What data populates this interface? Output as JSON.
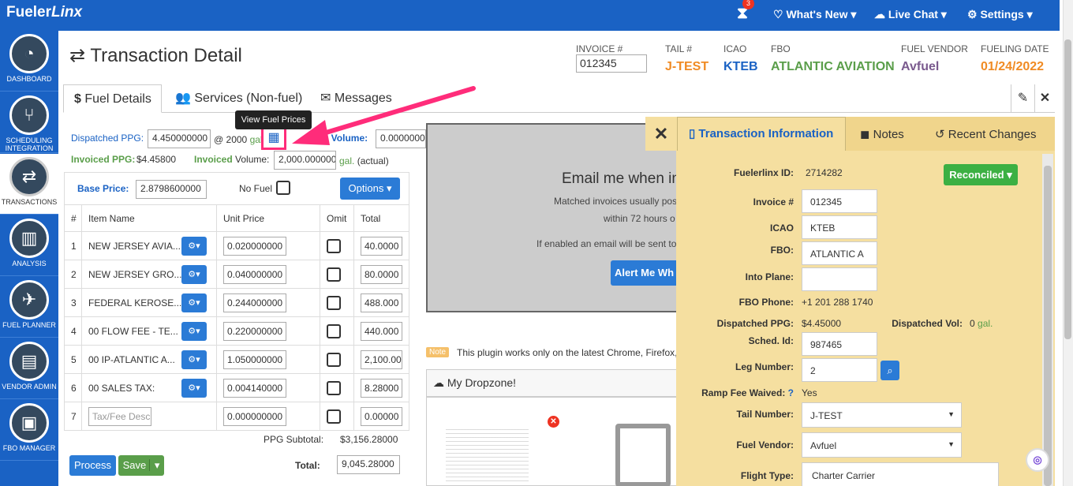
{
  "app": {
    "logo_main": "Fueler",
    "logo_italic": "Linx",
    "notif_count": "3",
    "whats_new": "What's New",
    "live_chat": "Live Chat",
    "settings": "Settings"
  },
  "sidebar": [
    {
      "label": "DASHBOARD",
      "icon": "dashboard-icon",
      "glyph": "◔"
    },
    {
      "label": "SCHEDULING INTEGRATION",
      "icon": "branch-icon",
      "glyph": "⑂"
    },
    {
      "label": "TRANSACTIONS",
      "icon": "transfer-icon",
      "glyph": "⇄"
    },
    {
      "label": "ANALYSIS",
      "icon": "bar-chart-icon",
      "glyph": "▥"
    },
    {
      "label": "FUEL PLANNER",
      "icon": "plane-icon",
      "glyph": "✈"
    },
    {
      "label": "VENDOR ADMIN",
      "icon": "document-icon",
      "glyph": "▤"
    },
    {
      "label": "FBO MANAGER",
      "icon": "briefcase-icon",
      "glyph": "▣"
    }
  ],
  "header": {
    "title": "Transaction Detail",
    "invoice_label": "INVOICE #",
    "invoice_value": "012345",
    "tail_label": "TAIL #",
    "tail_value": "J-TEST",
    "icao_label": "ICAO",
    "icao_value": "KTEB",
    "fbo_label": "FBO",
    "fbo_value": "ATLANTIC AVIATION",
    "vendor_label": "FUEL VENDOR",
    "vendor_value": "Avfuel",
    "date_label": "FUELING DATE",
    "date_value": "01/24/2022"
  },
  "colors": {
    "tail": "#f08b24",
    "icao": "#1a62c4",
    "fbo": "#5a9e4a",
    "vendor": "#7a5a8e",
    "date": "#f08b24",
    "accent": "#1a62c4",
    "pink": "#ff2c7a"
  },
  "tabs": {
    "fuel": "Fuel Details",
    "services": "Services (Non-fuel)",
    "messages": "Messages"
  },
  "tooltip": "View Fuel Prices",
  "fuel": {
    "dispatched_ppg_label": "Dispatched PPG:",
    "dispatched_ppg_value": "4.450000000",
    "at_gal": "@ 2000",
    "gal": "gal.",
    "quoted_volume_label": "oted Volume:",
    "quoted_volume_value": "0.00000000",
    "invoiced_ppg_label": "Invoiced PPG:",
    "invoiced_ppg_value": "$4.45800",
    "invoiced_word": "Invoiced",
    "volume_word": "Volume:",
    "invoiced_volume_value": "2,000.000000",
    "gal2": "gal.",
    "actual": "(actual)",
    "base_price_label": "Base Price:",
    "base_price_value": "2.8798600000",
    "no_fuel_label": "No Fuel",
    "options_label": "Options"
  },
  "table": {
    "headers": [
      "#",
      "Item Name",
      "Unit Price",
      "Omit",
      "Total"
    ],
    "rows": [
      {
        "num": "1",
        "name": "NEW JERSEY AVIA...",
        "price": "0.020000000",
        "total": "40.0000"
      },
      {
        "num": "2",
        "name": "NEW JERSEY GRO...",
        "price": "0.040000000",
        "total": "80.0000"
      },
      {
        "num": "3",
        "name": "FEDERAL KEROSE...",
        "price": "0.244000000",
        "total": "488.000"
      },
      {
        "num": "4",
        "name": "00 FLOW FEE - TE...",
        "price": "0.220000000",
        "total": "440.000"
      },
      {
        "num": "5",
        "name": "00 IP-ATLANTIC A...",
        "price": "1.050000000",
        "total": "2,100.00"
      },
      {
        "num": "6",
        "name": "00 SALES TAX:",
        "price": "0.004140000",
        "total": "8.28000"
      }
    ],
    "new_row": {
      "num": "7",
      "placeholder": "Tax/Fee Desc",
      "price": "0.000000000",
      "total": "0.00000"
    },
    "ppg_subtotal_label": "PPG Subtotal:",
    "ppg_subtotal_value": "$3,156.28000",
    "total_label": "Total:",
    "total_value": "9,045.28000"
  },
  "actions": {
    "process": "Process",
    "save": "Save"
  },
  "middle": {
    "email_heading": "Email me when in",
    "matched_text": "Matched invoices usually pos",
    "within_text": "within 72 hours o",
    "enabled_text": "If enabled an email will be sent to",
    "alert_button": "Alert Me Wh",
    "note_badge": "Note",
    "note_text": "This plugin works only on the latest Chrome, Firefox,",
    "dropzone_title": "My Dropzone!"
  },
  "panel": {
    "tabs": {
      "info": "Transaction Information",
      "notes": "Notes",
      "recent": "Recent Changes"
    },
    "fuelerlinx_id_label": "Fuelerlinx ID:",
    "fuelerlinx_id_value": "2714282",
    "status": "Reconciled",
    "invoice_label": "Invoice #",
    "invoice_value": "012345",
    "icao_label": "ICAO",
    "icao_value": "KTEB",
    "fbo_label": "FBO:",
    "fbo_value": "ATLANTIC A",
    "into_plane_label": "Into Plane:",
    "into_plane_value": "",
    "fbo_phone_label": "FBO Phone:",
    "fbo_phone_value": "+1 201 288 1740",
    "dispatched_ppg_label": "Dispatched PPG:",
    "dispatched_ppg_value": "$4.45000",
    "dispatched_vol_label": "Dispatched Vol:",
    "dispatched_vol_value": "0",
    "dispatched_vol_unit": "gal.",
    "sched_id_label": "Sched. Id:",
    "sched_id_value": "987465",
    "leg_number_label": "Leg Number:",
    "leg_number_value": "2",
    "ramp_fee_label": "Ramp Fee Waived:",
    "ramp_fee_value": "Yes",
    "tail_label": "Tail Number:",
    "tail_value": "J-TEST",
    "vendor_label": "Fuel Vendor:",
    "vendor_value": "Avfuel",
    "flight_type_label": "Flight Type:",
    "flight_type_value": "Charter Carrier"
  }
}
